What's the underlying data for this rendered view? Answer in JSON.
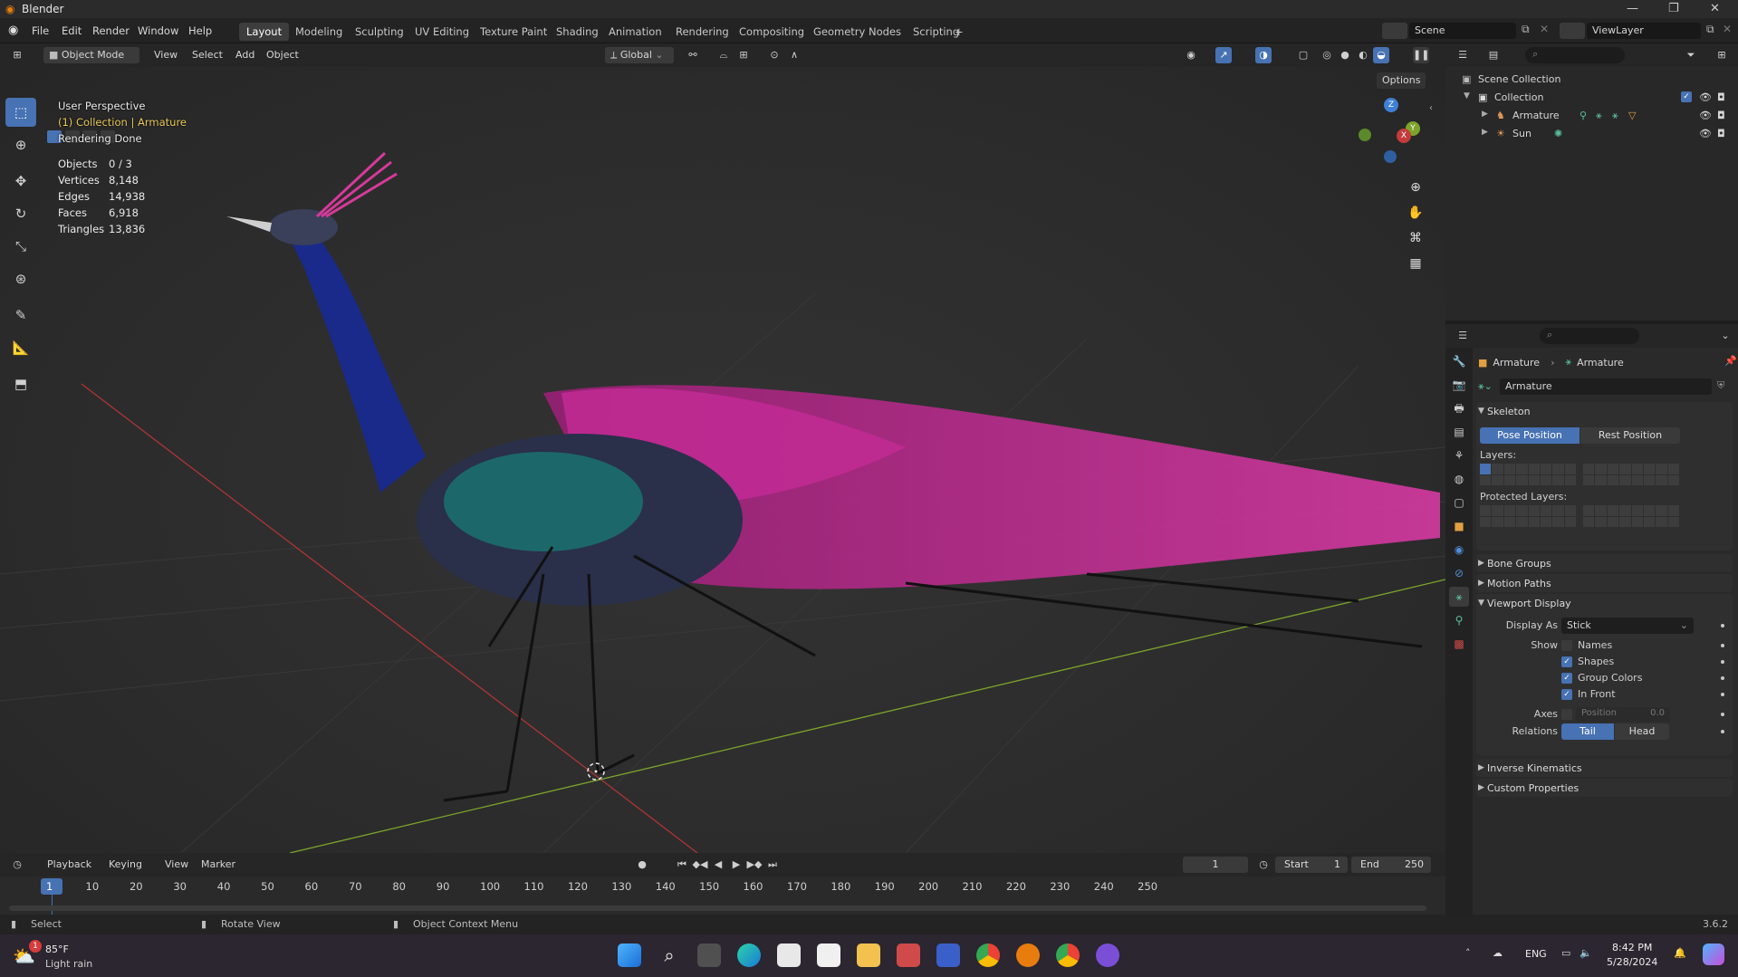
{
  "window": {
    "title": "Blender",
    "controls": [
      "—",
      "❐",
      "✕"
    ]
  },
  "menubar": {
    "menus": [
      "File",
      "Edit",
      "Render",
      "Window",
      "Help"
    ],
    "workspaces": [
      "Layout",
      "Modeling",
      "Sculpting",
      "UV Editing",
      "Texture Paint",
      "Shading",
      "Animation",
      "Rendering",
      "Compositing",
      "Geometry Nodes",
      "Scripting"
    ],
    "active_workspace": "Layout",
    "add_tab": "+",
    "scene": "Scene",
    "view_layer": "ViewLayer"
  },
  "viewport_header": {
    "mode": "Object Mode",
    "menus": [
      "View",
      "Select",
      "Add",
      "Object"
    ],
    "orientation": "Global",
    "options": "Options"
  },
  "viewport_overlay": {
    "perspective": "User Perspective",
    "collection_line": "(1) Collection | Armature",
    "render_status": "Rendering Done",
    "stats": [
      {
        "label": "Objects",
        "value": "0 / 3"
      },
      {
        "label": "Vertices",
        "value": "8,148"
      },
      {
        "label": "Edges",
        "value": "14,938"
      },
      {
        "label": "Faces",
        "value": "6,918"
      },
      {
        "label": "Triangles",
        "value": "13,836"
      }
    ],
    "gizmo_axes": [
      "Z",
      "Y",
      "X"
    ]
  },
  "outliner": {
    "root": "Scene Collection",
    "collection": "Collection",
    "items": [
      {
        "name": "Armature"
      },
      {
        "name": "Sun"
      }
    ]
  },
  "properties": {
    "breadcrumb_object": "Armature",
    "breadcrumb_data": "Armature",
    "datablock_name": "Armature",
    "skeleton": {
      "title": "Skeleton",
      "pose_position": "Pose Position",
      "rest_position": "Rest Position",
      "layers_label": "Layers:",
      "protected_layers_label": "Protected Layers:"
    },
    "collapsed_panels": [
      "Bone Groups",
      "Motion Paths"
    ],
    "viewport_display": {
      "title": "Viewport Display",
      "display_as_label": "Display As",
      "display_as_value": "Stick",
      "show_label": "Show",
      "show_options": [
        {
          "label": "Names",
          "checked": false
        },
        {
          "label": "Shapes",
          "checked": true
        },
        {
          "label": "Group Colors",
          "checked": true
        },
        {
          "label": "In Front",
          "checked": true
        }
      ],
      "axes_label": "Axes",
      "axes_position_label": "Position",
      "axes_position_value": "0.0",
      "relations_label": "Relations",
      "relations_tail": "Tail",
      "relations_head": "Head"
    },
    "bottom_panels": [
      "Inverse Kinematics",
      "Custom Properties"
    ]
  },
  "timeline": {
    "menus": [
      "Playback",
      "Keying",
      "View",
      "Marker"
    ],
    "current_frame": "1",
    "start_label": "Start",
    "start_value": "1",
    "end_label": "End",
    "end_value": "250",
    "ticks": [
      "1",
      "10",
      "20",
      "30",
      "40",
      "50",
      "60",
      "70",
      "80",
      "90",
      "100",
      "110",
      "120",
      "130",
      "140",
      "150",
      "160",
      "170",
      "180",
      "190",
      "200",
      "210",
      "220",
      "230",
      "240",
      "250"
    ]
  },
  "statusbar": {
    "hints": [
      "Select",
      "Rotate View",
      "Object Context Menu"
    ],
    "version": "3.6.2"
  },
  "taskbar": {
    "weather_temp": "85°F",
    "weather_desc": "Light rain",
    "badge": "1",
    "lang": "ENG",
    "time": "8:42 PM",
    "date": "5/28/2024"
  },
  "colors": {
    "accent": "#4772b3",
    "x_axis": "#c43b3b",
    "y_axis": "#7da32a",
    "z_axis": "#3f7fd6"
  }
}
